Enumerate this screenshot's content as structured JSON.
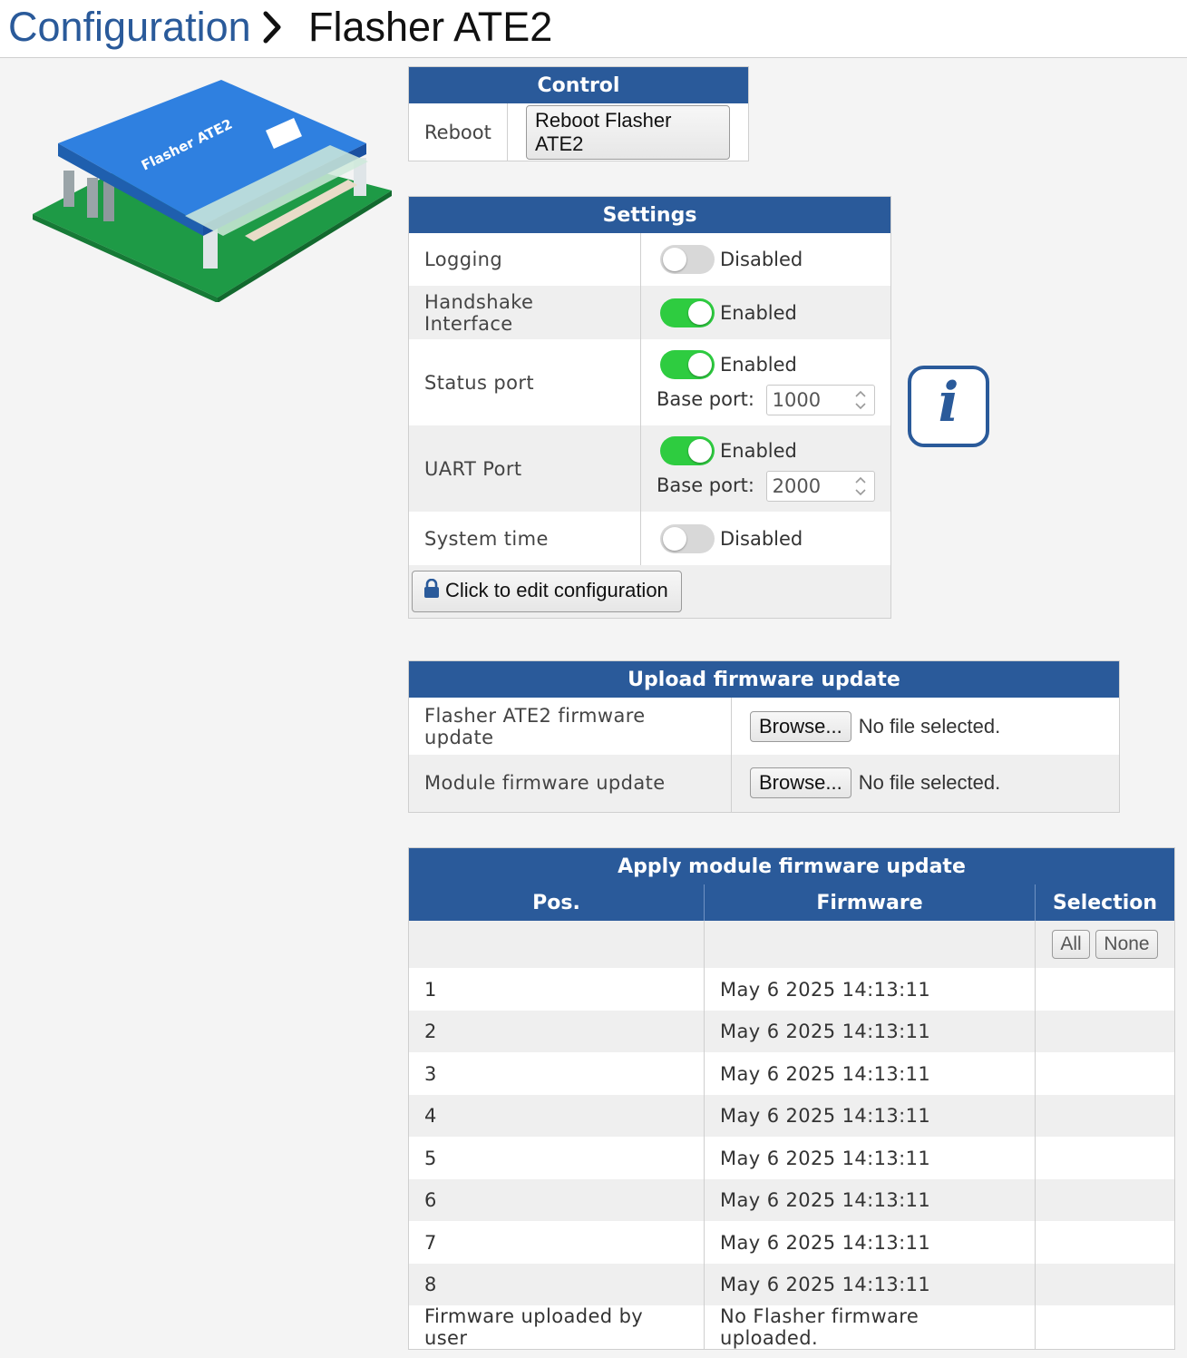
{
  "breadcrumb": {
    "parent": "Configuration",
    "current": "Flasher ATE2"
  },
  "board_image": {
    "label": "Flasher ATE2",
    "colors": {
      "board_top": "#2f80e0",
      "pcb": "#1faa4a"
    }
  },
  "control": {
    "title": "Control",
    "reboot_label": "Reboot",
    "reboot_button": "Reboot Flasher ATE2"
  },
  "settings": {
    "title": "Settings",
    "base_port_label": "Base port:",
    "rows": [
      {
        "label": "Logging",
        "state": "off",
        "state_text": "Disabled"
      },
      {
        "label": "Handshake Interface",
        "state": "on",
        "state_text": "Enabled"
      },
      {
        "label": "Status port",
        "state": "on",
        "state_text": "Enabled",
        "base_port": "1000"
      },
      {
        "label": "UART Port",
        "state": "on",
        "state_text": "Enabled",
        "base_port": "2000"
      },
      {
        "label": "System time",
        "state": "off",
        "state_text": "Disabled"
      }
    ],
    "edit_button": "Click to edit configuration"
  },
  "upload": {
    "title": "Upload firmware update",
    "rows": [
      {
        "label": "Flasher ATE2 firmware update",
        "button": "Browse...",
        "status": "No file selected."
      },
      {
        "label": "Module firmware update",
        "button": "Browse...",
        "status": "No file selected."
      }
    ]
  },
  "apply": {
    "title": "Apply module firmware update",
    "headers": {
      "pos": "Pos.",
      "firmware": "Firmware",
      "selection": "Selection"
    },
    "all_button": "All",
    "none_button": "None",
    "rows": [
      {
        "pos": "1",
        "firmware": "May 6 2025 14:13:11"
      },
      {
        "pos": "2",
        "firmware": "May 6 2025 14:13:11"
      },
      {
        "pos": "3",
        "firmware": "May 6 2025 14:13:11"
      },
      {
        "pos": "4",
        "firmware": "May 6 2025 14:13:11"
      },
      {
        "pos": "5",
        "firmware": "May 6 2025 14:13:11"
      },
      {
        "pos": "6",
        "firmware": "May 6 2025 14:13:11"
      },
      {
        "pos": "7",
        "firmware": "May 6 2025 14:13:11"
      },
      {
        "pos": "8",
        "firmware": "May 6 2025 14:13:11"
      }
    ],
    "footer_row": {
      "pos": "Firmware uploaded by user",
      "firmware": "No Flasher firmware uploaded."
    }
  },
  "colors": {
    "accent": "#2a5a9a",
    "toggle_on": "#2ecc40",
    "toggle_off": "#d8d8d8"
  },
  "icons": {
    "info": "info-icon",
    "lock": "lock-icon",
    "breadcrumb_separator": "chevron-right-icon"
  }
}
